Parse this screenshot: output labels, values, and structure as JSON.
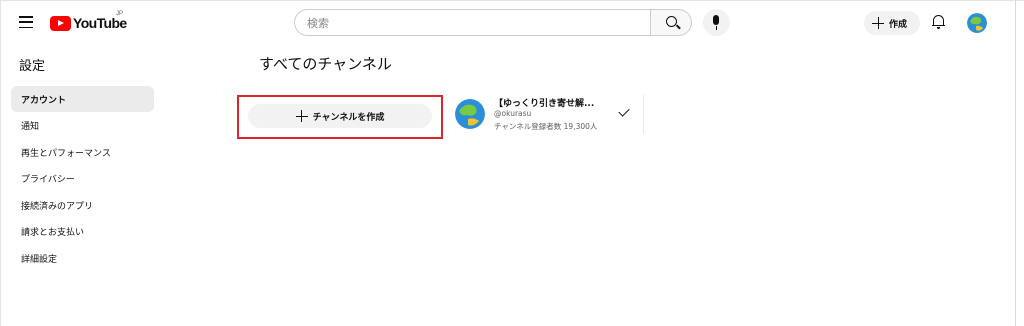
{
  "header": {
    "logo_text": "YouTube",
    "region": "JP",
    "search": {
      "placeholder": "検索"
    },
    "create_label": "作成"
  },
  "sidebar": {
    "title": "設定",
    "items": [
      {
        "label": "アカウント",
        "active": true
      },
      {
        "label": "通知",
        "active": false
      },
      {
        "label": "再生とパフォーマンス",
        "active": false
      },
      {
        "label": "プライバシー",
        "active": false
      },
      {
        "label": "接続済みのアプリ",
        "active": false
      },
      {
        "label": "請求とお支払い",
        "active": false
      },
      {
        "label": "詳細設定",
        "active": false
      }
    ]
  },
  "main": {
    "title": "すべてのチャンネル",
    "create_channel_label": "チャンネルを作成",
    "channel": {
      "name": "【ゆっくり引き寄せ解...",
      "handle": "@okurasu",
      "subscribers": "チャンネル登録者数 19,300人"
    }
  },
  "colors": {
    "brand_red": "#ff0000",
    "highlight_red": "#e0222a",
    "active_bg": "#ebebeb"
  },
  "icons": [
    "menu-icon",
    "youtube-logo-icon",
    "search-icon",
    "mic-icon",
    "plus-icon",
    "bell-icon",
    "avatar",
    "checkmark-icon"
  ]
}
